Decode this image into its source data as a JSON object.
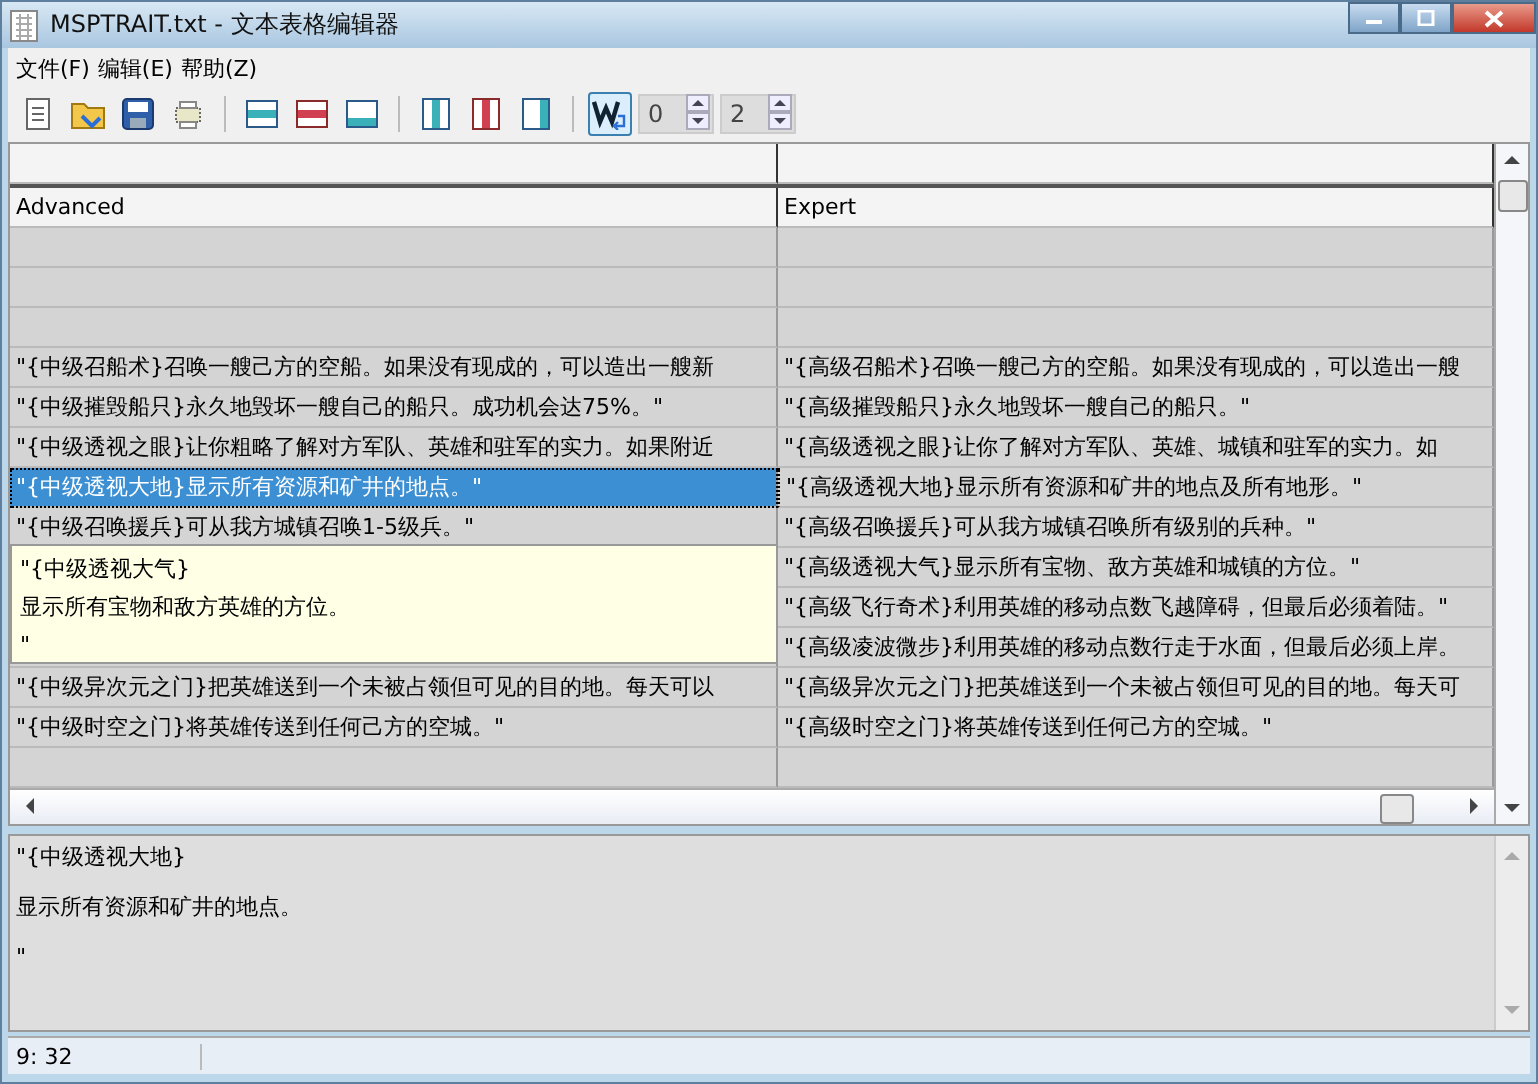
{
  "window": {
    "title": "MSPTRAIT.txt - 文本表格编辑器"
  },
  "menu": [
    {
      "label": "文件(F)"
    },
    {
      "label": "编辑(E)"
    },
    {
      "label": "帮助(Z)"
    }
  ],
  "toolbar": {
    "wrap_toggle": {
      "on": true
    },
    "spinners": [
      {
        "value": "0"
      },
      {
        "value": "2"
      }
    ]
  },
  "table": {
    "columns": [
      "Advanced",
      "Expert"
    ],
    "rows": [
      {
        "selected": false
      },
      {
        "selected": false
      },
      {
        "selected": false
      },
      {
        "selected": false,
        "advanced": "\"{中级召船术}召唤一艘己方的空船。如果没有现成的，可以造出一艘新",
        "expert": "\"{高级召船术}召唤一艘己方的空船。如果没有现成的，可以造出一艘"
      },
      {
        "selected": false,
        "advanced": "\"{中级摧毁船只}永久地毁坏一艘自己的船只。成功机会达75%。\"",
        "expert": "\"{高级摧毁船只}永久地毁坏一艘自己的船只。\""
      },
      {
        "selected": false,
        "advanced": "\"{中级透视之眼}让你粗略了解对方军队、英雄和驻军的实力。如果附近",
        "expert": "\"{高级透视之眼}让你了解对方军队、英雄、城镇和驻军的实力。如"
      },
      {
        "selected": true,
        "advanced": "\"{中级透视大地}显示所有资源和矿井的地点。\"",
        "expert": "\"{高级透视大地}显示所有资源和矿井的地点及所有地形。\""
      },
      {
        "selected": false,
        "advanced": "\"{中级召唤援兵}可从我方城镇召唤1-5级兵。\"",
        "expert": "\"{高级召唤援兵}可从我方城镇召唤所有级别的兵种。\""
      },
      {
        "selected": false,
        "expert": "\"{高级透视大气}显示所有宝物、敌方英雄和城镇的方位。\""
      },
      {
        "selected": false,
        "expert": "\"{高级飞行奇术}利用英雄的移动点数飞越障碍，但最后必须着陆。\""
      },
      {
        "selected": false,
        "expert": "\"{高级凌波微步}利用英雄的移动点数行走于水面，但最后必须上岸。"
      },
      {
        "selected": false,
        "advanced": "\"{中级异次元之门}把英雄送到一个未被占领但可见的目的地。每天可以",
        "expert": "\"{高级异次元之门}把英雄送到一个未被占领但可见的目的地。每天可"
      },
      {
        "selected": false,
        "advanced": "\"{中级时空之门}将英雄传送到任何己方的空城。\"",
        "expert": "\"{高级时空之门}将英雄传送到任何己方的空城。\""
      },
      {
        "selected": false
      }
    ]
  },
  "cell_editor": {
    "lines": [
      "\"{中级透视大气}",
      "显示所有宝物和敌方英雄的方位。",
      "\""
    ]
  },
  "preview": {
    "lines": [
      "\"{中级透视大地}",
      "显示所有资源和矿井的地点。",
      "\""
    ]
  },
  "status_bar": {
    "position": "9: 32"
  }
}
